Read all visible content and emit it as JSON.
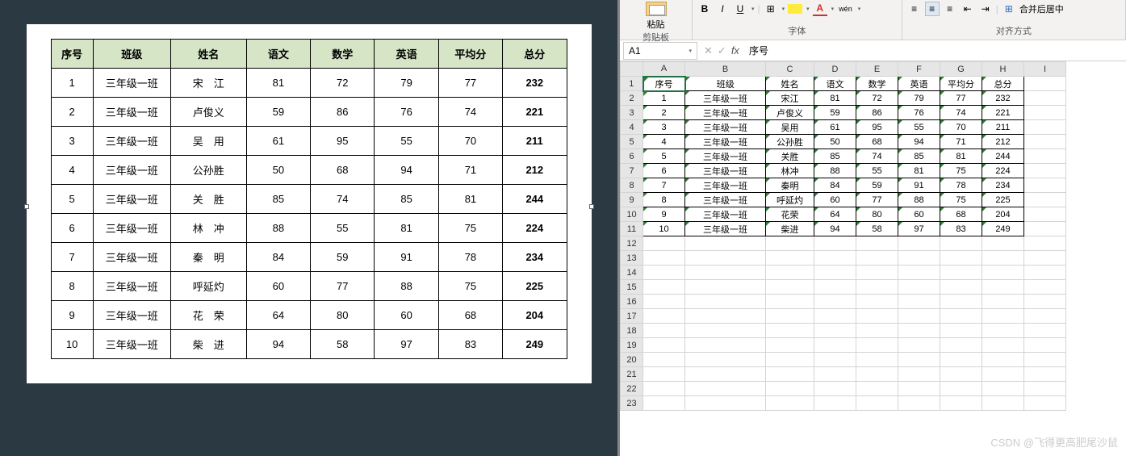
{
  "doc": {
    "headers": [
      "序号",
      "班级",
      "姓名",
      "语文",
      "数学",
      "英语",
      "平均分",
      "总分"
    ],
    "rows": [
      [
        "1",
        "三年级一班",
        "宋　江",
        "81",
        "72",
        "79",
        "77",
        "232"
      ],
      [
        "2",
        "三年级一班",
        "卢俊义",
        "59",
        "86",
        "76",
        "74",
        "221"
      ],
      [
        "3",
        "三年级一班",
        "吴　用",
        "61",
        "95",
        "55",
        "70",
        "211"
      ],
      [
        "4",
        "三年级一班",
        "公孙胜",
        "50",
        "68",
        "94",
        "71",
        "212"
      ],
      [
        "5",
        "三年级一班",
        "关　胜",
        "85",
        "74",
        "85",
        "81",
        "244"
      ],
      [
        "6",
        "三年级一班",
        "林　冲",
        "88",
        "55",
        "81",
        "75",
        "224"
      ],
      [
        "7",
        "三年级一班",
        "秦　明",
        "84",
        "59",
        "91",
        "78",
        "234"
      ],
      [
        "8",
        "三年级一班",
        "呼延灼",
        "60",
        "77",
        "88",
        "75",
        "225"
      ],
      [
        "9",
        "三年级一班",
        "花　荣",
        "64",
        "80",
        "60",
        "68",
        "204"
      ],
      [
        "10",
        "三年级一班",
        "柴　进",
        "94",
        "58",
        "97",
        "83",
        "249"
      ]
    ]
  },
  "excel": {
    "ribbon": {
      "paste": "粘贴",
      "clipboard": "剪贴板",
      "font": "字体",
      "align": "对齐方式",
      "merge": "合并后居中",
      "bold": "B",
      "italic": "I",
      "underline": "U",
      "wen": "wén"
    },
    "namebox": "A1",
    "fx_value": "序号",
    "cols": [
      "A",
      "B",
      "C",
      "D",
      "E",
      "F",
      "G",
      "H",
      "I"
    ],
    "rows": [
      [
        "序号",
        "班级",
        "姓名",
        "语文",
        "数学",
        "英语",
        "平均分",
        "总分",
        ""
      ],
      [
        "1",
        "三年级一班",
        "宋江",
        "81",
        "72",
        "79",
        "77",
        "232",
        ""
      ],
      [
        "2",
        "三年级一班",
        "卢俊义",
        "59",
        "86",
        "76",
        "74",
        "221",
        ""
      ],
      [
        "3",
        "三年级一班",
        "吴用",
        "61",
        "95",
        "55",
        "70",
        "211",
        ""
      ],
      [
        "4",
        "三年级一班",
        "公孙胜",
        "50",
        "68",
        "94",
        "71",
        "212",
        ""
      ],
      [
        "5",
        "三年级一班",
        "关胜",
        "85",
        "74",
        "85",
        "81",
        "244",
        ""
      ],
      [
        "6",
        "三年级一班",
        "林冲",
        "88",
        "55",
        "81",
        "75",
        "224",
        ""
      ],
      [
        "7",
        "三年级一班",
        "秦明",
        "84",
        "59",
        "91",
        "78",
        "234",
        ""
      ],
      [
        "8",
        "三年级一班",
        "呼延灼",
        "60",
        "77",
        "88",
        "75",
        "225",
        ""
      ],
      [
        "9",
        "三年级一班",
        "花荣",
        "64",
        "80",
        "60",
        "68",
        "204",
        ""
      ],
      [
        "10",
        "三年级一班",
        "柴进",
        "94",
        "58",
        "97",
        "83",
        "249",
        ""
      ],
      [
        "",
        "",
        "",
        "",
        "",
        "",
        "",
        "",
        ""
      ],
      [
        "",
        "",
        "",
        "",
        "",
        "",
        "",
        "",
        ""
      ],
      [
        "",
        "",
        "",
        "",
        "",
        "",
        "",
        "",
        ""
      ],
      [
        "",
        "",
        "",
        "",
        "",
        "",
        "",
        "",
        ""
      ],
      [
        "",
        "",
        "",
        "",
        "",
        "",
        "",
        "",
        ""
      ],
      [
        "",
        "",
        "",
        "",
        "",
        "",
        "",
        "",
        ""
      ],
      [
        "",
        "",
        "",
        "",
        "",
        "",
        "",
        "",
        ""
      ],
      [
        "",
        "",
        "",
        "",
        "",
        "",
        "",
        "",
        ""
      ],
      [
        "",
        "",
        "",
        "",
        "",
        "",
        "",
        "",
        ""
      ],
      [
        "",
        "",
        "",
        "",
        "",
        "",
        "",
        "",
        ""
      ],
      [
        "",
        "",
        "",
        "",
        "",
        "",
        "",
        "",
        ""
      ],
      [
        "",
        "",
        "",
        "",
        "",
        "",
        "",
        "",
        ""
      ]
    ],
    "data_rows": 11,
    "data_cols": 8
  },
  "watermark": "CSDN @飞得更高肥尾沙鼠"
}
